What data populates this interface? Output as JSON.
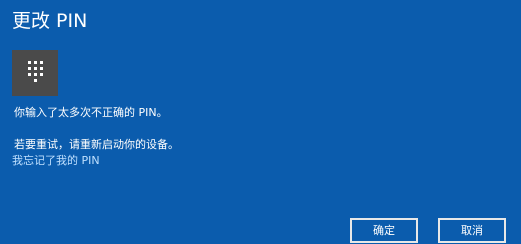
{
  "dialog": {
    "title": "更改 PIN",
    "icon": "keypad-icon",
    "message_line1": "你输入了太多次不正确的 PIN。",
    "message_line2": "若要重试，请重新启动你的设备。",
    "forgot_link": "我忘记了我的 PIN",
    "ok_label": "确定",
    "cancel_label": "取消"
  },
  "colors": {
    "background": "#0b5cad",
    "tile": "#4a4a4a",
    "link": "#bfe0ff",
    "text": "#ffffff"
  }
}
